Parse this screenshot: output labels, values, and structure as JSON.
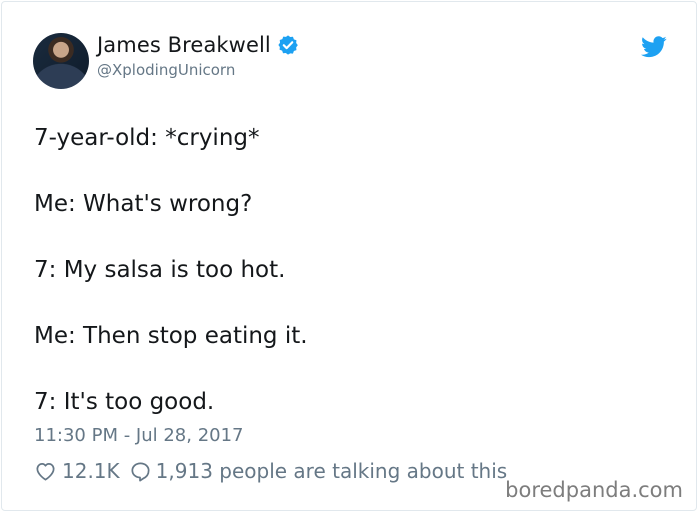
{
  "tweet": {
    "author_name": "James Breakwell",
    "author_handle": "@XplodingUnicorn",
    "lines": [
      "7-year-old: *crying*",
      "Me: What's wrong?",
      "7: My salsa is too hot.",
      "Me: Then stop eating it.",
      "7: It's too good."
    ],
    "timestamp": "11:30 PM - Jul 28, 2017",
    "likes": "12.1K",
    "conversation": "1,913 people are talking about this"
  },
  "watermark": "boredpanda.com",
  "colors": {
    "twitter_blue": "#1da1f2",
    "text": "#14171a",
    "muted": "#657786",
    "border": "#e1e8ed"
  },
  "icons": {
    "verified": "verified-badge-icon",
    "bird": "twitter-bird-icon",
    "like": "heart-icon",
    "reply": "comment-bubble-icon"
  }
}
